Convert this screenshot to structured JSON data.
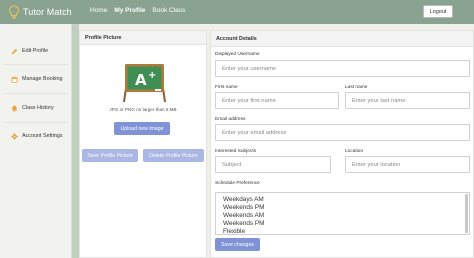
{
  "navbar": {
    "brand": "Tutor Match",
    "links": [
      "Home",
      "My Profile",
      "Book Class"
    ],
    "active_link": "My Profile",
    "logout_label": "Logout",
    "background_color": "#8aa391"
  },
  "sidebar": {
    "items": [
      {
        "label": "Edit Profile",
        "icon": "pencil-icon"
      },
      {
        "label": "Manage Booking",
        "icon": "calendar-icon"
      },
      {
        "label": "Class History",
        "icon": "bell-icon"
      },
      {
        "label": "Account Settings",
        "icon": "gear-icon"
      }
    ]
  },
  "profile_picture": {
    "title": "Profile Picture",
    "image_icon": "chalkboard-a-plus-icon",
    "hint": "JPG or PNG no larger than 5 MB",
    "upload_label": "Upload new image",
    "save_label": "Save Profile Picture",
    "delete_label": "Delete Profile Picture"
  },
  "account_details": {
    "title": "Account Details",
    "username": {
      "label": "Displayed Username",
      "placeholder": "Enter your username"
    },
    "first_name": {
      "label": "First name",
      "placeholder": "Enter your first name"
    },
    "last_name": {
      "label": "Last name",
      "placeholder": "Enter your last name"
    },
    "email": {
      "label": "Email address",
      "placeholder": "Enter your email address"
    },
    "subjects": {
      "label": "Interested Subjects",
      "placeholder": "Subject"
    },
    "location": {
      "label": "Location",
      "placeholder": "Enter your location"
    },
    "schedule": {
      "label": "Schedule Preference",
      "options": [
        "Weekdays AM",
        "Weekends PM",
        "Weekends AM",
        "Weekends PM",
        "Flexible"
      ]
    },
    "save_label": "Save changes"
  },
  "colors": {
    "primary_button": "#7f93d6",
    "secondary_button": "#aab7e4",
    "accent_icon": "#e8a33c"
  }
}
